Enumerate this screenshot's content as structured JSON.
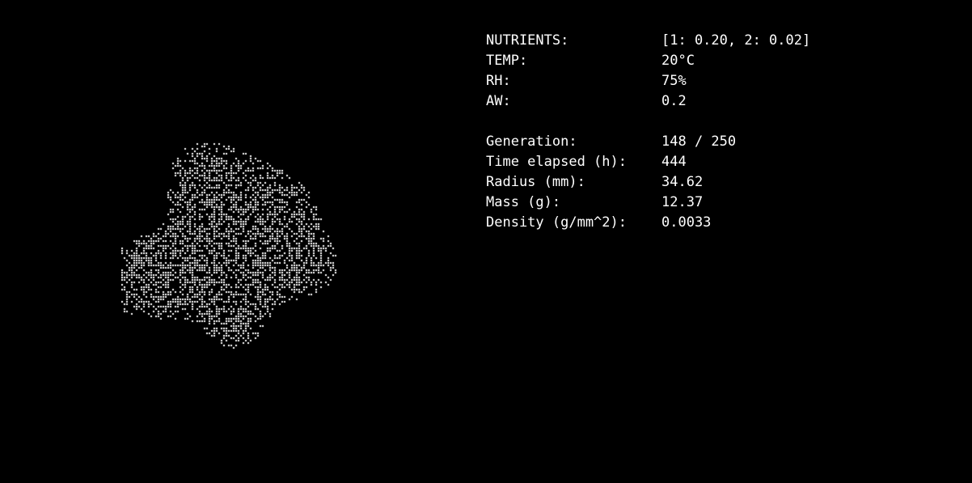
{
  "environment": {
    "nutrients": {
      "label": "NUTRIENTS:",
      "value": "[1: 0.20, 2: 0.02]"
    },
    "temp": {
      "label": "TEMP:",
      "value": "20°C"
    },
    "rh": {
      "label": "RH:",
      "value": "75%"
    },
    "aw": {
      "label": "AW:",
      "value": "0.2"
    }
  },
  "simulation": {
    "generation": {
      "label": "Generation:",
      "value": "148 / 250"
    },
    "time_elapsed": {
      "label": "Time elapsed (h):",
      "value": "444"
    },
    "radius": {
      "label": "Radius (mm):",
      "value": "34.62"
    },
    "mass": {
      "label": "Mass (g):",
      "value": "12.37"
    },
    "density": {
      "label": "Density (g/mm^2):",
      "value": "0.0033"
    }
  },
  "colors": {
    "background": "#000000",
    "foreground": "#ffffff",
    "colony": "#ffffff"
  }
}
